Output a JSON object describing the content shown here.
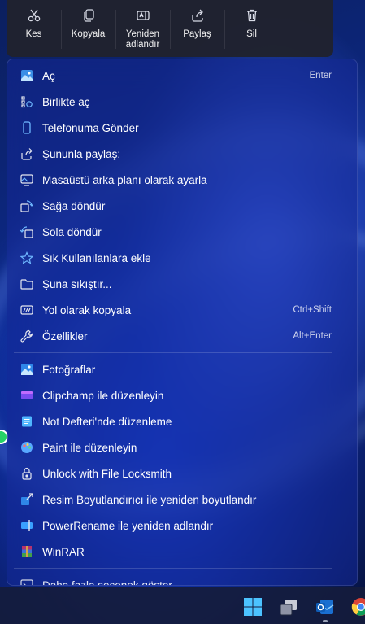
{
  "toolbar": {
    "buttons": [
      {
        "label": "Kes",
        "icon": "cut-icon"
      },
      {
        "label": "Kopyala",
        "icon": "copy-icon"
      },
      {
        "label": "Yeniden\nadlandır",
        "icon": "rename-icon"
      },
      {
        "label": "Paylaş",
        "icon": "share-icon"
      },
      {
        "label": "Sil",
        "icon": "delete-icon"
      }
    ]
  },
  "menu": {
    "group1": [
      {
        "label": "Aç",
        "shortcut": "Enter",
        "icon": "photo-icon"
      },
      {
        "label": "Birlikte aç",
        "shortcut": "",
        "icon": "open-with-icon"
      },
      {
        "label": "Telefonuma Gönder",
        "shortcut": "",
        "icon": "phone-icon"
      },
      {
        "label": "Şununla paylaş:",
        "shortcut": "",
        "icon": "share-icon"
      },
      {
        "label": "Masaüstü arka planı olarak ayarla",
        "shortcut": "",
        "icon": "wallpaper-icon"
      },
      {
        "label": "Sağa döndür",
        "shortcut": "",
        "icon": "rotate-right-icon"
      },
      {
        "label": "Sola döndür",
        "shortcut": "",
        "icon": "rotate-left-icon"
      },
      {
        "label": "Sık Kullanılanlara ekle",
        "shortcut": "",
        "icon": "star-icon"
      },
      {
        "label": "Şuna sıkıştır...",
        "shortcut": "",
        "icon": "zip-folder-icon"
      },
      {
        "label": "Yol olarak kopyala",
        "shortcut": "Ctrl+Shift",
        "icon": "copy-path-icon"
      },
      {
        "label": "Özellikler",
        "shortcut": "Alt+Enter",
        "icon": "wrench-icon"
      }
    ],
    "group2": [
      {
        "label": "Fotoğraflar",
        "icon": "photos-app-icon"
      },
      {
        "label": "Clipchamp ile düzenleyin",
        "icon": "clipchamp-icon"
      },
      {
        "label": "Not Defteri'nde düzenleme",
        "icon": "notepad-icon"
      },
      {
        "label": "Paint ile düzenleyin",
        "icon": "paint-icon"
      },
      {
        "label": "Unlock with File Locksmith",
        "icon": "lock-icon"
      },
      {
        "label": "Resim Boyutlandırıcı ile yeniden boyutlandır",
        "icon": "image-resizer-icon"
      },
      {
        "label": "PowerRename ile yeniden adlandır",
        "icon": "powerrename-icon"
      },
      {
        "label": "WinRAR",
        "icon": "winrar-icon"
      }
    ],
    "more": {
      "label": "Daha fazla seçenek göster",
      "icon": "more-options-icon"
    }
  },
  "taskbar": {
    "icons": [
      "windows-start-icon",
      "task-view-icon",
      "outlook-icon",
      "chrome-icon"
    ]
  },
  "colors": {
    "accent": "#5aa0ff",
    "menu_bg": "#142896",
    "taskbar_bg": "#141c3c"
  }
}
